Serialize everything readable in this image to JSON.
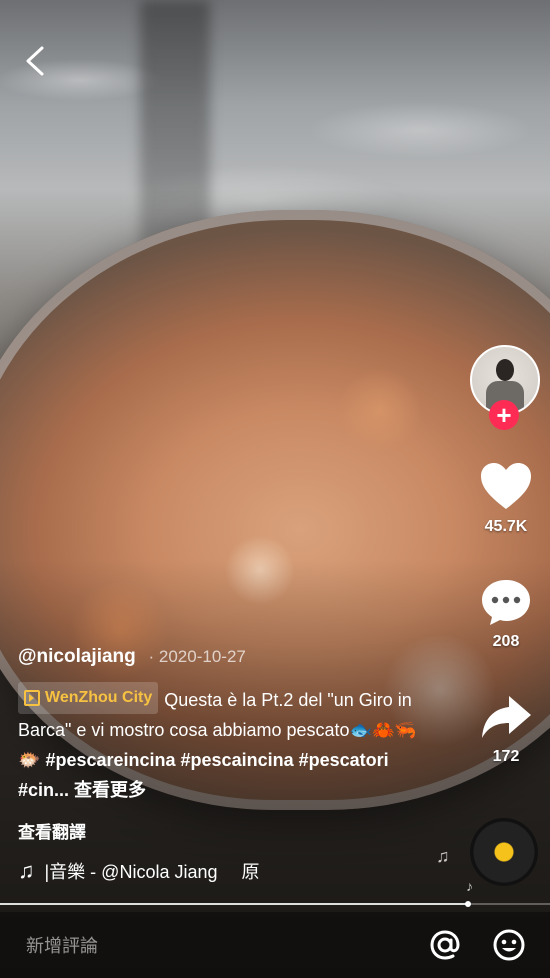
{
  "post": {
    "author": "@nicolajiang",
    "date": "2020-10-27",
    "location": "WenZhou City",
    "description": "Questa è la Pt.2 del \"un Giro in Barca\" e vi mostro cosa abbiamo pescato",
    "emojis": "🐟🦀🦐🐡",
    "hashtags": [
      "#pescareincina",
      "#pescaincina",
      "#pescatori",
      "#cin..."
    ],
    "see_more": "查看更多",
    "translate": "查看翻譯"
  },
  "actions": {
    "likes": "45.7K",
    "comments": "208",
    "shares": "172"
  },
  "music": {
    "label": "|音樂 - @Nicola Jiang",
    "original": "原"
  },
  "progress": {
    "fraction": 0.85
  },
  "comment_bar": {
    "placeholder": "新增評論"
  },
  "colors": {
    "follow": "#fe2c55",
    "location": "#f7c241"
  },
  "icons": [
    "back-arrow-icon",
    "heart-icon",
    "comment-icon",
    "share-icon",
    "music-note-icon",
    "at-icon",
    "emoji-icon",
    "plus-icon"
  ]
}
